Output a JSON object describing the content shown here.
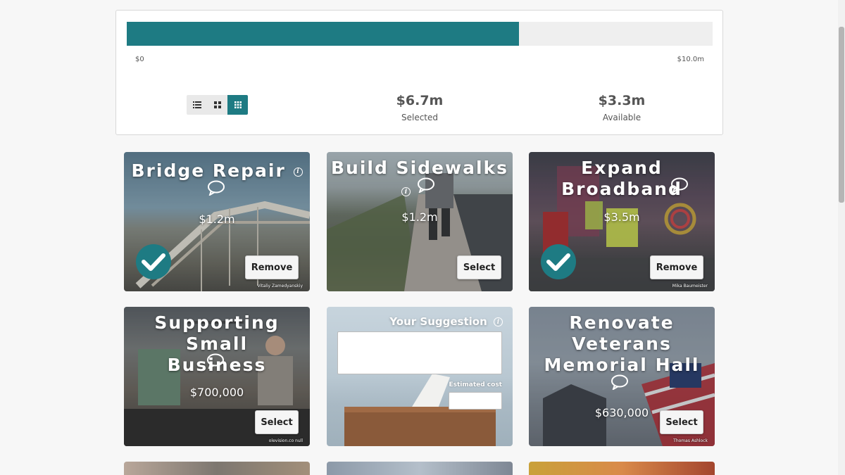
{
  "budget": {
    "min_label": "$0",
    "max_label": "$10.0m",
    "selected_value": "$6.7m",
    "selected_label": "Selected",
    "available_value": "$3.3m",
    "available_label": "Available",
    "progress_fraction": 0.67,
    "accent_color": "#1e7b83"
  },
  "view_toggle": {
    "options": [
      "list-view-icon",
      "grid-view-icon",
      "compact-grid-view-icon"
    ],
    "active": "compact-grid-view-icon"
  },
  "cards": [
    {
      "title": "Bridge Repair",
      "price": "$1.2m",
      "button": "Remove",
      "selected": true,
      "credit": "Vitaliy Zamedyanskiy"
    },
    {
      "title": "Build Sidewalks",
      "price": "$1.2m",
      "button": "Select",
      "selected": false,
      "credit": ""
    },
    {
      "title": "Expand Broadband",
      "price": "$3.5m",
      "button": "Remove",
      "selected": true,
      "credit": "Mika Baumeister"
    },
    {
      "title": "Supporting Small Business",
      "price": "$700,000",
      "button": "Select",
      "selected": false,
      "credit": "olevision.co null"
    },
    {
      "title": "Renovate Veterans Memorial Hall",
      "price": "$630,000",
      "button": "Select",
      "selected": false,
      "credit": "Thomas Ashlock"
    }
  ],
  "suggestion": {
    "title": "Your Suggestion",
    "cost_label": "Estimated cost"
  }
}
